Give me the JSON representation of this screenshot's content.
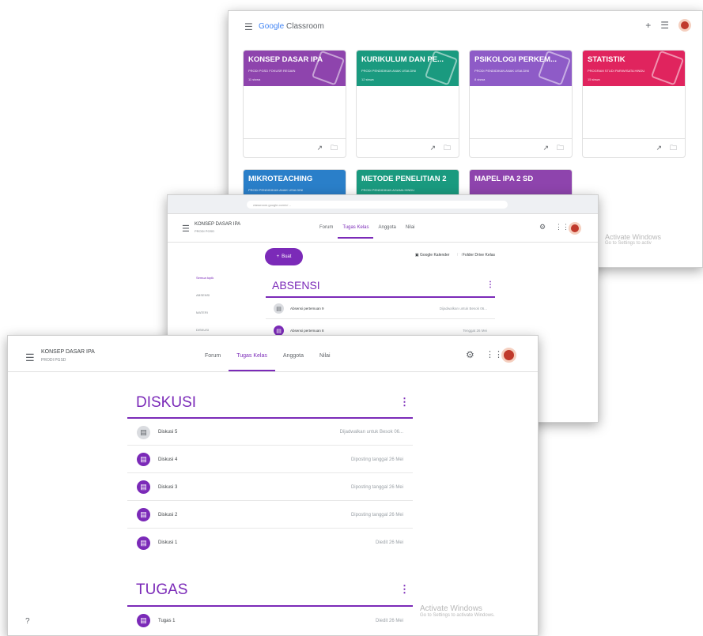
{
  "classroom_home": {
    "menu_icon": "hamburger-icon",
    "brand_google": "Google",
    "brand_classroom": " Classroom",
    "top_icons": [
      "+",
      "☰"
    ],
    "cards": [
      {
        "title": "KONSEP DASAR IPA",
        "subtitle": "PRODI PGSD FOKUSR REGAIN",
        "count": "11 siswa",
        "color": "#8e44ad"
      },
      {
        "title": "KURIKULUM DAN PE...",
        "subtitle": "PRODI PENDIDIKAN ANAK USIA DINI",
        "count": "12 siswa",
        "color": "#1a9a7f"
      },
      {
        "title": "PSIKOLOGI PERKEM...",
        "subtitle": "PRODI PENDIDIKAN ANAK USIA DINI",
        "count": "8 siswa",
        "color": "#8e5bc7"
      },
      {
        "title": "STATISTIK",
        "subtitle": "PROGRAM STUDI PARIWISATA HINDU",
        "count": "15 siswa",
        "color": "#e0245e"
      },
      {
        "title": "MIKROTEACHING",
        "subtitle": "PRODI PENDIDIKAN ANAK USIA DINI",
        "count": "",
        "color": "#2a7fc9"
      },
      {
        "title": "METODE PENELITIAN 2",
        "subtitle": "PRODI PENDIDIKAN AGAMA HINDU",
        "count": "",
        "color": "#1a9a7f"
      },
      {
        "title": "MAPEL IPA 2 SD",
        "subtitle": "",
        "count": "",
        "color": "#8e44ad"
      }
    ],
    "card_icons": [
      "↗",
      "🗀"
    ],
    "watermark_title": "Activate Windows",
    "watermark_sub": "Go to Settings to activ"
  },
  "class_absensi": {
    "url": "classroom.google.com/c/…",
    "class_name": "KONSEP DASAR IPA",
    "class_section": "PRODI PGSD",
    "tabs": [
      "Forum",
      "Tugas Kelas",
      "Anggota",
      "Nilai"
    ],
    "active_tab": 1,
    "create_label": "Buat",
    "calendar_link": "Google Kalender",
    "drive_link": "Folder Drive Kelas",
    "sidebar": [
      "Semua topik",
      "ABSENSI",
      "MATERI",
      "DISKUSI"
    ],
    "section_title": "ABSENSI",
    "rows": [
      {
        "label": "Absensi pertemuan 9",
        "status": "Dijadwalkan untuk Besok 06..."
      },
      {
        "label": "Absensi pertemuan 8",
        "status": "Tenggat 26 Mei"
      }
    ]
  },
  "class_diskusi": {
    "class_name": "KONSEP DASAR IPA",
    "class_section": "PRODI PGSD",
    "tabs": [
      "Forum",
      "Tugas Kelas",
      "Anggota",
      "Nilai"
    ],
    "active_tab": 1,
    "section_title": "DISKUSI",
    "rows": [
      {
        "label": "Diskusi 5",
        "status": "Dijadwalkan untuk Besok 06..."
      },
      {
        "label": "Diskusi 4",
        "status": "Diposting tanggal 26 Mei"
      },
      {
        "label": "Diskusi 3",
        "status": "Diposting tanggal 26 Mei"
      },
      {
        "label": "Diskusi 2",
        "status": "Diposting tanggal 26 Mei"
      },
      {
        "label": "Diskusi 1",
        "status": "Diedit 26 Mei"
      }
    ],
    "section2_title": "TUGAS",
    "section2_rows": [
      {
        "label": "Tugas 1",
        "status": "Diedit 26 Mei"
      }
    ],
    "help_icon": "?",
    "watermark_title": "Activate Windows",
    "watermark_sub": "Go to Settings to activate Windows."
  },
  "colors": {
    "accent": "#7b2ab8"
  }
}
